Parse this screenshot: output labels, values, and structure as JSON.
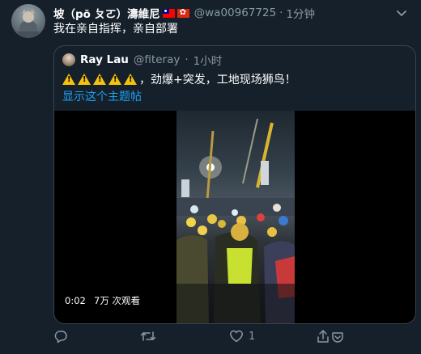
{
  "tweet": {
    "author_name": "坡（pō ㄆㄛ）濤維尼",
    "handle": "@wa00967725",
    "separator": "·",
    "time": "1分钟",
    "text": "我在亲自指挥，亲自部署"
  },
  "quoted": {
    "author_name": "Ray Lau",
    "handle": "@fiteray",
    "separator": "·",
    "time": "1小时",
    "text": "，劲爆+突发，工地现场狮鸟！",
    "warning_count": 5,
    "show_thread": "显示这个主题帖",
    "video": {
      "duration": "0:02",
      "views": "7万 次观看"
    }
  },
  "actions": {
    "reply_count": "",
    "retweet_count": "",
    "like_count": "1",
    "share_count": ""
  },
  "colors": {
    "background": "#15202b",
    "secondary_text": "#8899a6",
    "link": "#1da1f2",
    "border": "#38444d"
  },
  "icons": [
    "avatar",
    "flag-taiwan-icon",
    "flag-hongkong-icon",
    "chevron-down-icon",
    "warning-icon",
    "reply-icon",
    "retweet-icon",
    "like-icon",
    "share-icon"
  ]
}
